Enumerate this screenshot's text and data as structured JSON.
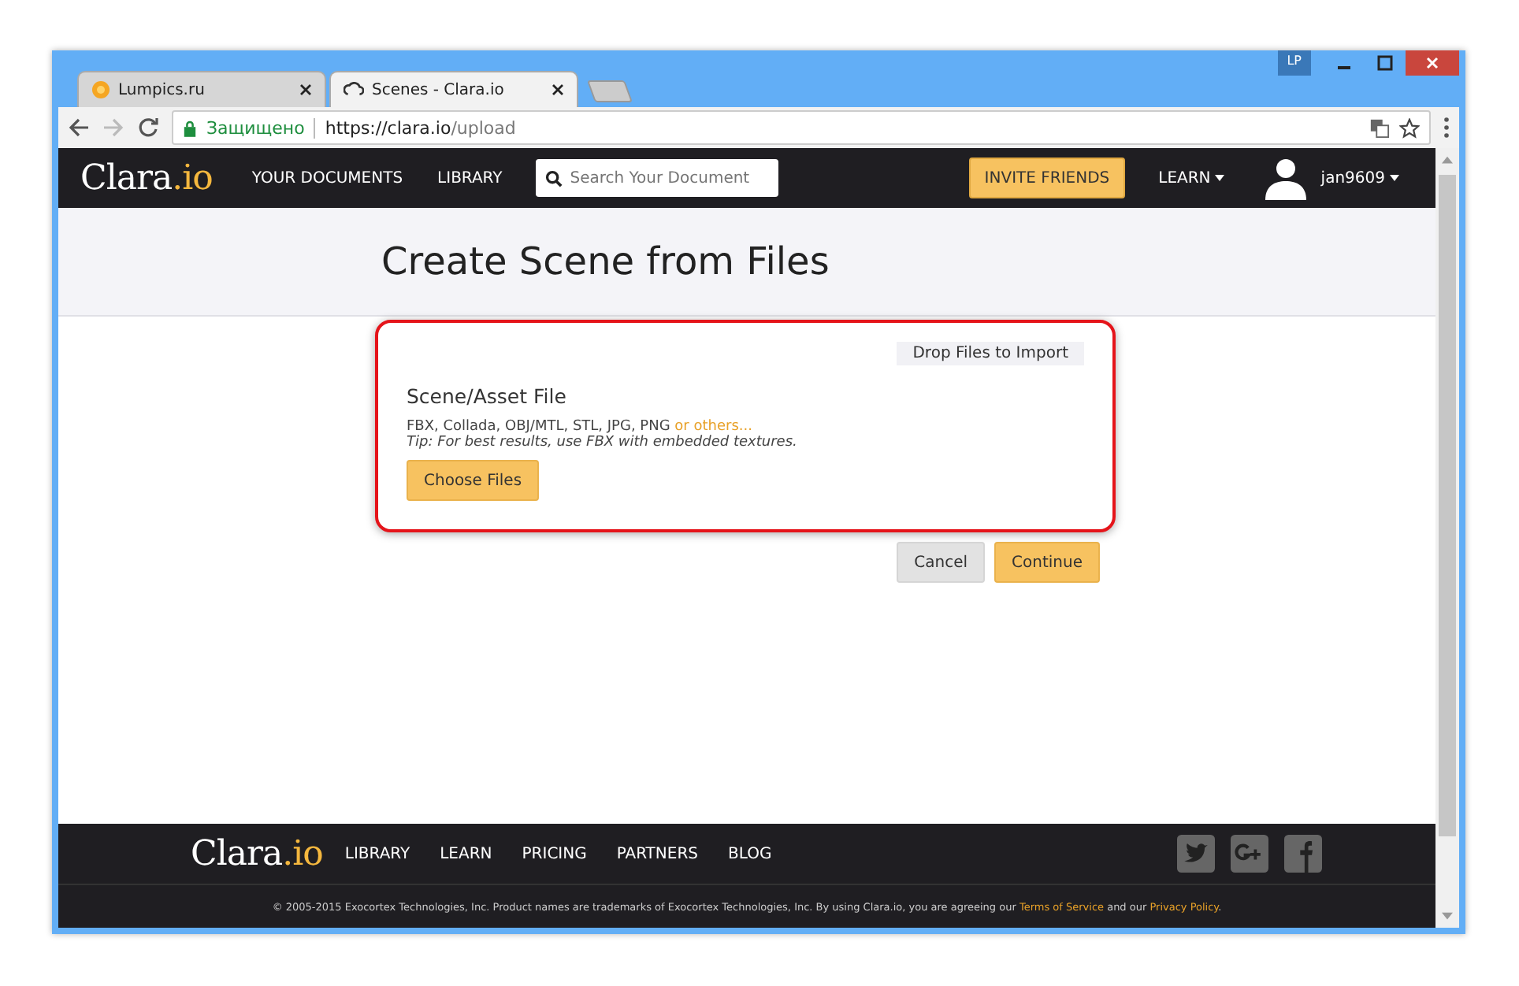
{
  "browser": {
    "tabs": [
      {
        "title": "Lumpics.ru",
        "selected": false
      },
      {
        "title": "Scenes - Clara.io",
        "selected": true
      }
    ],
    "profile_badge": "LP",
    "secure_label": "Защищено",
    "url_host": "https://clara.io",
    "url_path": "/upload"
  },
  "navbar": {
    "logo": {
      "name": "Clara",
      "suffix": ".io"
    },
    "links": [
      "YOUR DOCUMENTS",
      "LIBRARY"
    ],
    "search": {
      "placeholder": "Search Your Document"
    },
    "invite_button": "INVITE FRIENDS",
    "learn_menu": "LEARN",
    "username": "jan9609"
  },
  "page": {
    "title": "Create Scene from Files",
    "upload_card": {
      "drop_hint": "Drop Files to Import",
      "heading": "Scene/Asset File",
      "formats": "FBX, Collada, OBJ/MTL, STL, JPG, PNG",
      "formats_link": "or others...",
      "tip": "Tip: For best results, use FBX with embedded textures.",
      "choose_button": "Choose Files",
      "highlighted": true
    },
    "buttons": [
      {
        "label": "Cancel",
        "kind": "secondary"
      },
      {
        "label": "Continue",
        "kind": "primary"
      }
    ]
  },
  "footer": {
    "logo": {
      "name": "Clara",
      "suffix": ".io"
    },
    "links": [
      "LIBRARY",
      "LEARN",
      "PRICING",
      "PARTNERS",
      "BLOG"
    ],
    "copyright": "© 2005-2015 Exocortex Technologies, Inc. Product names are trademarks of Exocortex Technologies, Inc. By using Clara.io, you are agreeing our",
    "terms_link": "Terms of Service",
    "and_text": "and our",
    "privacy_link": "Privacy Policy",
    "period": "."
  }
}
